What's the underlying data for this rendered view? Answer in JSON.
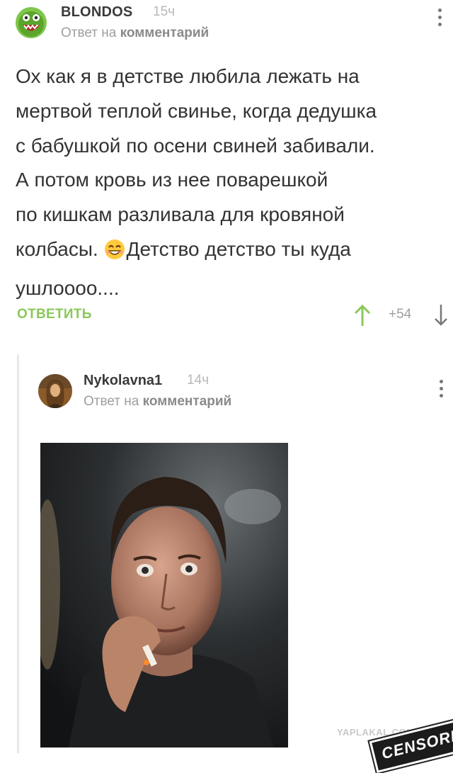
{
  "comment1": {
    "author": "BLONDOS",
    "time": "15ч",
    "reply_prefix": "Ответ на",
    "reply_target": "комментарий",
    "avatar_icon": "green-monster-avatar",
    "lines": [
      "Ох как я в детстве любила лежать на",
      "мертвой теплой свинье, когда дедушка",
      "с бабушкой по осени свиней забивали.",
      "А потом кровь из нее поварешкой",
      "по кишкам разливала для кровяной"
    ],
    "line6_before": "колбасы.",
    "emoji_icon": "grinning-smiley-emoji",
    "line6_after": "Детство детство ты куда",
    "line7": "ушлоооо....",
    "reply_button": "ОТВЕТИТЬ",
    "score": "+54"
  },
  "comment2": {
    "author": "Nykolavna1",
    "time": "14ч",
    "reply_prefix": "Ответ на",
    "reply_target": "комментарий",
    "avatar_icon": "portrait-painting-avatar",
    "image_icon": "man-smoking-cigarette-photo"
  },
  "watermark": "YAPLAKAL.COM",
  "stamp": "CENSORED",
  "colors": {
    "accent_green": "#8ac858",
    "text": "#333333",
    "muted": "#9e9e9e"
  }
}
